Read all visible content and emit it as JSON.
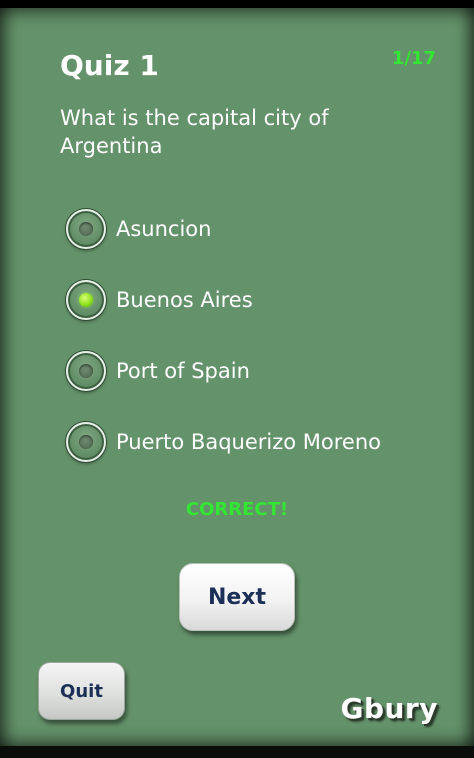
{
  "quiz": {
    "title": "Quiz 1",
    "counter": "1/17",
    "question": "What is the capital city of Argentina"
  },
  "options": [
    {
      "label": "Asuncion",
      "selected": false
    },
    {
      "label": "Buenos Aires",
      "selected": true
    },
    {
      "label": "Port of Spain",
      "selected": false
    },
    {
      "label": "Puerto Baquerizo Moreno",
      "selected": false
    }
  ],
  "result": {
    "text": "CORRECT!"
  },
  "buttons": {
    "next_label": "Next",
    "quit_label": "Quit"
  },
  "brand": {
    "text": "Gbury"
  },
  "colors": {
    "panel_background": "#64926a",
    "result_green": "#33e633",
    "button_text": "#1b2f57",
    "selected_radio": "#8fe21c"
  }
}
